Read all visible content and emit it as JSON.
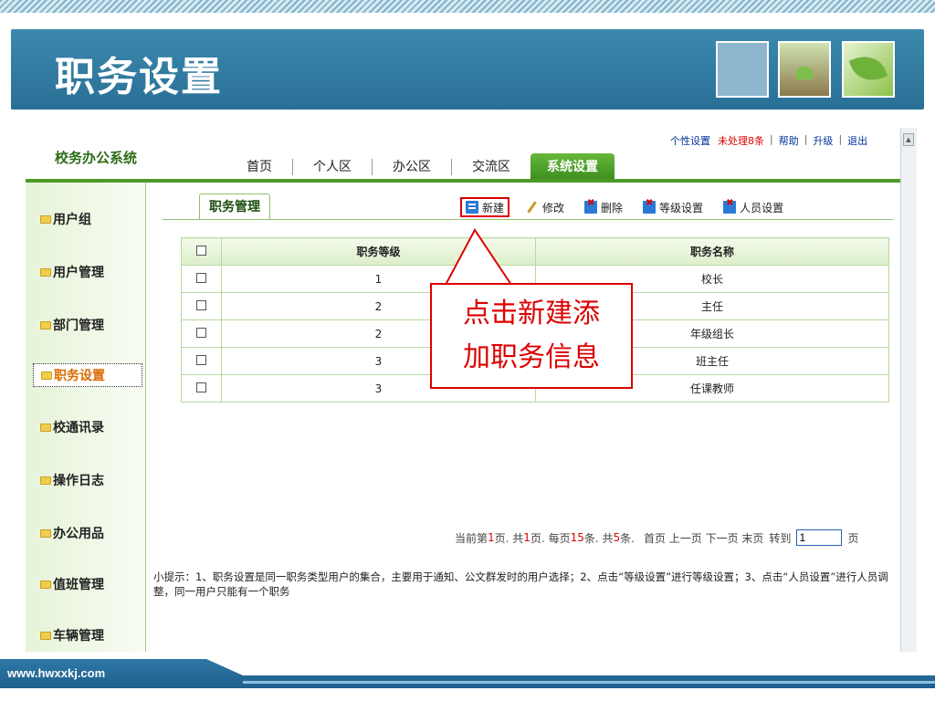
{
  "slide": {
    "title": "职务设置",
    "footer_url": "www.hwxxkj.com"
  },
  "app": {
    "name": "校务办公系统",
    "nav": [
      "首页",
      "个人区",
      "办公区",
      "交流区",
      "系统设置"
    ],
    "util_links": {
      "personal": "个性设置",
      "pending": "未处理8条",
      "help": "帮助",
      "upgrade": "升级",
      "logout": "退出"
    }
  },
  "sidebar": {
    "items": [
      "用户组",
      "用户管理",
      "部门管理",
      "职务设置",
      "校通讯录",
      "操作日志",
      "办公用品",
      "值班管理",
      "车辆管理"
    ]
  },
  "content": {
    "tab": "职务管理",
    "toolbar": {
      "new": "新建",
      "edit": "修改",
      "delete": "删除",
      "level": "等级设置",
      "staff": "人员设置"
    },
    "table": {
      "headers": {
        "level": "职务等级",
        "name": "职务名称"
      },
      "rows": [
        {
          "level": "1",
          "name": "校长"
        },
        {
          "level": "2",
          "name": "主任"
        },
        {
          "level": "2",
          "name": "年级组长"
        },
        {
          "level": "3",
          "name": "班主任"
        },
        {
          "level": "3",
          "name": "任课教师"
        }
      ]
    },
    "pager": {
      "p1": "当前第",
      "current": "1",
      "p2": "页. 共",
      "pages": "1",
      "p3": "页. 每页",
      "per_page": "15",
      "p4": "条. 共",
      "total": "5",
      "p5": "条.",
      "links": "首页 上一页 下一页 末页",
      "goto": "转到",
      "goto_value": "1",
      "page_unit": "页"
    },
    "hint": "小提示：1、职务设置是同一职务类型用户的集合，主要用于通知、公文群发时的用户选择；2、点击“等级设置”进行等级设置；3、点击“人员设置”进行人员调整，同一用户只能有一个职务"
  },
  "callout": {
    "line1": "点击新建添",
    "line2": "加职务信息"
  }
}
